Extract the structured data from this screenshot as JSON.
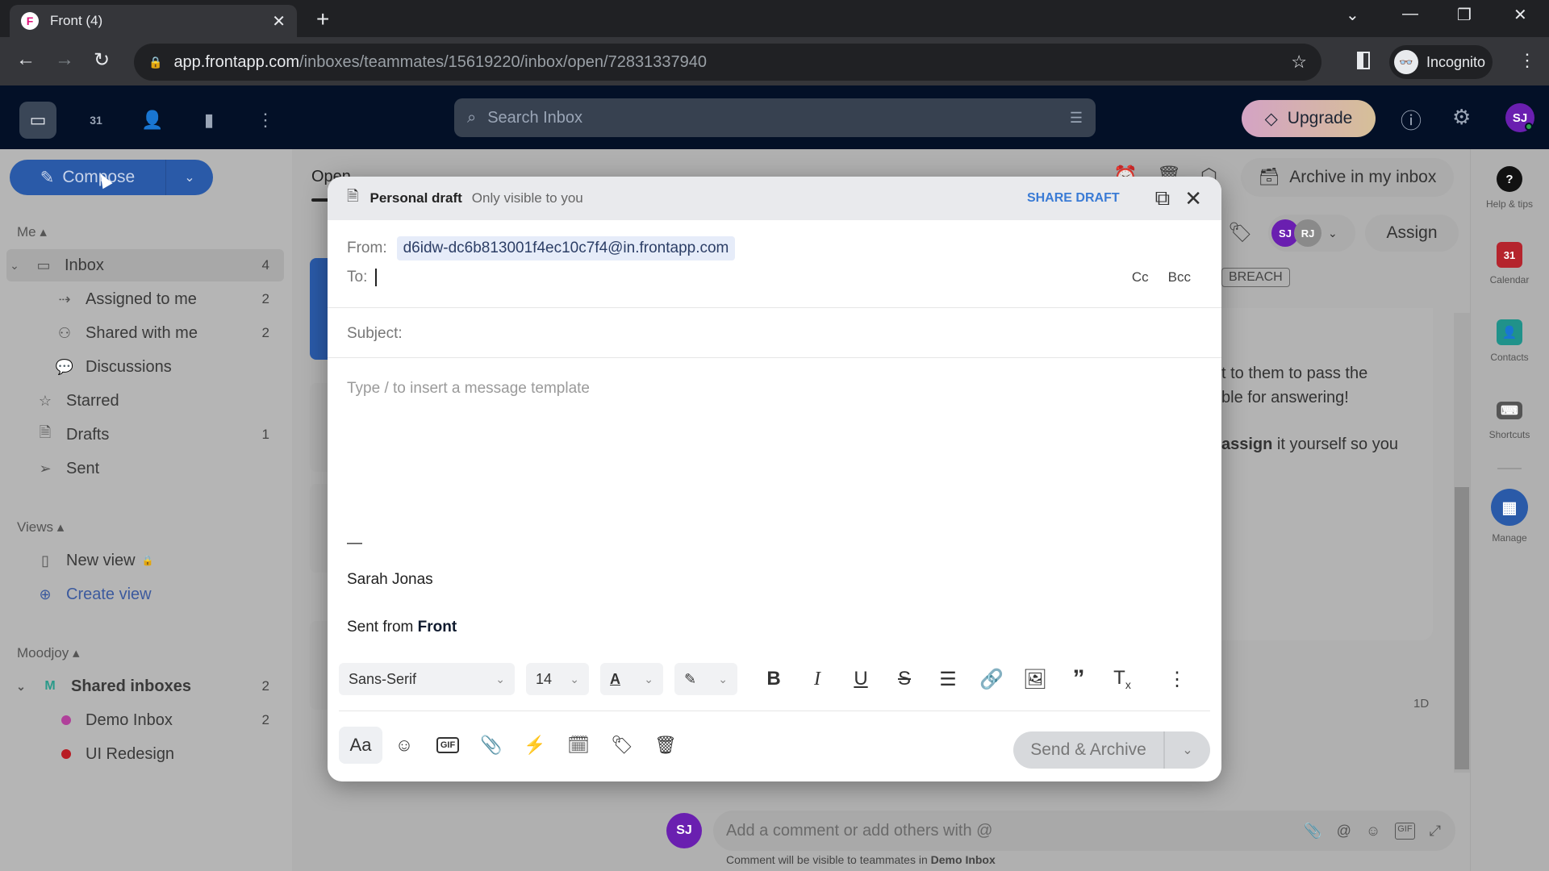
{
  "browser": {
    "tab_title": "Front (4)",
    "url_host": "app.frontapp.com",
    "url_path": "/inboxes/teammates/15619220/inbox/open/72831337940",
    "profile_label": "Incognito"
  },
  "app_header": {
    "search_placeholder": "Search Inbox",
    "upgrade_label": "Upgrade",
    "user_initials": "SJ"
  },
  "sidebar": {
    "compose_label": "Compose",
    "me_section": "Me",
    "items": [
      {
        "label": "Inbox",
        "count": "4"
      },
      {
        "label": "Assigned to me",
        "count": "2"
      },
      {
        "label": "Shared with me",
        "count": "2"
      },
      {
        "label": "Discussions",
        "count": ""
      },
      {
        "label": "Starred",
        "count": ""
      },
      {
        "label": "Drafts",
        "count": "1"
      },
      {
        "label": "Sent",
        "count": ""
      }
    ],
    "views_section": "Views",
    "views": [
      {
        "label": "New view"
      },
      {
        "label": "Create view"
      }
    ],
    "team_section": "Moodjoy",
    "team_items": [
      {
        "label": "Shared inboxes",
        "count": "2",
        "badge": "M"
      },
      {
        "label": "Demo Inbox",
        "count": "2",
        "color": "#b0409a"
      },
      {
        "label": "UI Redesign",
        "count": "",
        "color": "#b81c24"
      }
    ]
  },
  "list": {
    "tab_open": "Open"
  },
  "conversation": {
    "archive_label": "Archive in my inbox",
    "assign_label": "Assign",
    "assignees": [
      "SJ",
      "RJ"
    ],
    "tag_label": "BREACH",
    "text_line1": "t to them to pass the",
    "text_line2": "ble for answering!",
    "text_bold": "assign",
    "text_line3": " it yourself so you",
    "time_label": "1D",
    "comment_placeholder": "Add a comment or add others with @",
    "comment_note_prefix": "Comment will be visible to teammates in ",
    "comment_note_inbox": "Demo Inbox"
  },
  "rail": {
    "items": [
      {
        "label": "Help & tips"
      },
      {
        "label": "Calendar"
      },
      {
        "label": "Contacts"
      },
      {
        "label": "Shortcuts"
      },
      {
        "label": "Manage"
      }
    ]
  },
  "draft": {
    "title": "Personal draft",
    "visibility": "Only visible to you",
    "share_label": "SHARE DRAFT",
    "from_label": "From:",
    "from_value": "d6idw-dc6b813001f4ec10c7f4@in.frontapp.com",
    "to_label": "To:",
    "cc_label": "Cc",
    "bcc_label": "Bcc",
    "subject_label": "Subject:",
    "body_placeholder": "Type / to insert a message template",
    "signature_dash": "—",
    "signature_name": "Sarah Jonas",
    "signature_sent": "Sent from ",
    "signature_brand": "Front",
    "font_family": "Sans-Serif",
    "font_size": "14",
    "send_label": "Send & Archive"
  },
  "colors": {
    "accent": "#2a5aa8",
    "share": "#3a7bd5",
    "avatar": "#6a1fb0"
  }
}
